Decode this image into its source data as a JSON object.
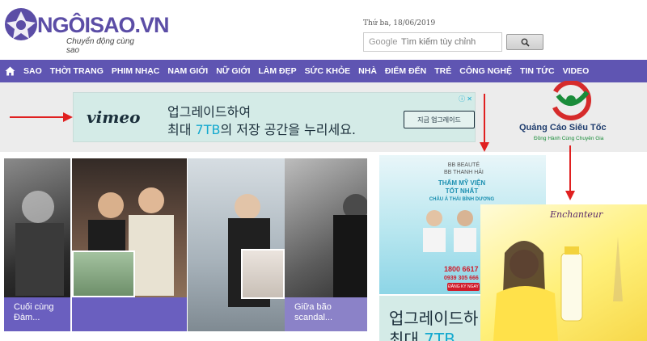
{
  "header": {
    "logo_text": "NGÔISAO.VN",
    "slogan": "Chuyển động cùng sao",
    "date": "Thứ ba, 18/06/2019",
    "search_prefix": "Google",
    "search_placeholder": "Tìm kiếm tùy chỉnh"
  },
  "nav": {
    "items": [
      "SAO",
      "THỜI TRANG",
      "PHIM NHẠC",
      "NAM GIỚI",
      "NỮ GIỚI",
      "LÀM ĐẸP",
      "SỨC KHỎE",
      "NHÀ",
      "ĐIỂM ĐẾN",
      "TRẺ",
      "CÔNG NGHỆ",
      "TIN TỨC",
      "VIDEO"
    ]
  },
  "ad_banner": {
    "brand": "vimeo",
    "line1": "업그레이드하여",
    "line2_prefix": "최대 ",
    "line2_accent": "7TB",
    "line2_suffix": "의 저장 공간을 누리세요.",
    "cta": "지금 업그레이드"
  },
  "brand_logo": {
    "name": "Quảng Cáo Siêu Tốc",
    "tagline": "Đồng Hành Cùng Chuyên Gia"
  },
  "stories": [
    {
      "caption_line1": "Cuối cùng",
      "caption_line2": "Đàm..."
    },
    {
      "caption_line1": "",
      "caption_line2": ""
    },
    {
      "caption_line1": "",
      "caption_line2": ""
    },
    {
      "caption_line1": "Giữa bão",
      "caption_line2": "scandal..."
    }
  ],
  "spa_ad": {
    "brand_line1": "BB BEAUTÉ",
    "brand_line2": "BB THANH HẢI",
    "title_line1": "THẨM MỸ VIỆN",
    "title_line2": "TỐT NHẤT",
    "title_line3": "CHÂU Á THÁI BÌNH DƯƠNG",
    "phone1": "1800 6617",
    "phone2": "0939 305 666",
    "button": "ĐĂNG KÝ NGAY"
  },
  "vimeo_ad2": {
    "line1": "업그레이드하",
    "line2_prefix": "최대 ",
    "line2_accent": "7TB"
  },
  "enchanteur_ad": {
    "brand": "Enchanteur"
  },
  "colors": {
    "nav_bg": "#5f55b2",
    "caption_bg": "#6a5fbf",
    "arrow": "#e02020"
  }
}
